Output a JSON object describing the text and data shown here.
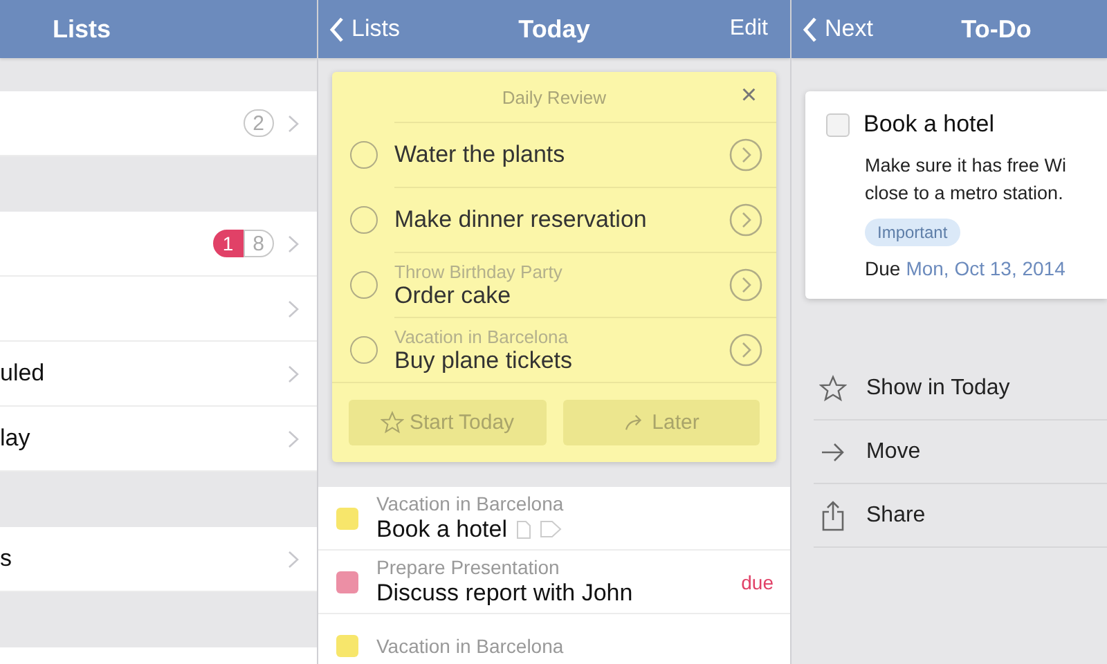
{
  "lists_pane": {
    "title": "Lists",
    "sections": [
      {
        "rows": [
          {
            "badges": [
              {
                "kind": "count",
                "text": "2"
              }
            ]
          }
        ]
      },
      {
        "rows": [
          {
            "badges": [
              {
                "kind": "due",
                "text": "1"
              },
              {
                "kind": "count",
                "text": "8"
              }
            ]
          },
          {},
          {
            "label": "uled"
          },
          {
            "label": "lay"
          }
        ]
      },
      {
        "rows": [
          {
            "label": "s"
          }
        ]
      },
      {
        "rows": [
          {}
        ]
      }
    ]
  },
  "today_pane": {
    "back": "Lists",
    "title": "Today",
    "action": "Edit",
    "review": {
      "title": "Daily Review",
      "close": "×",
      "items": [
        {
          "title": "Water the plants",
          "checked": false
        },
        {
          "title": "Make dinner reservation",
          "checked": false
        },
        {
          "project": "Throw Birthday Party",
          "title": "Order cake",
          "checked": false
        },
        {
          "project": "Vacation in Barcelona",
          "title": "Buy plane tickets",
          "checked": false
        }
      ],
      "buttons": [
        {
          "kind": "star",
          "label": "Start Today",
          "disabled": true
        },
        {
          "kind": "later",
          "label": "Later",
          "disabled": true
        }
      ]
    },
    "tasks": [
      {
        "project": "Vacation in Barcelona",
        "title": "Book a hotel",
        "color": "#f7e66b",
        "note": true,
        "tag": true
      },
      {
        "project": "Prepare Presentation",
        "title": "Discuss report with John",
        "color": "#ec8fa5",
        "due": "due"
      },
      {
        "project": "Vacation in Barcelona",
        "color": "#f7e66b"
      }
    ]
  },
  "todo_pane": {
    "back": "Next",
    "title": "To-Do",
    "card": {
      "checked": false,
      "title": "Book a hotel",
      "notes": [
        "Make sure it has free Wi",
        "close to a metro station."
      ],
      "tag": "Important",
      "due_label": "Due",
      "due_date": "Mon, Oct 13, 2014"
    },
    "actions": [
      {
        "kind": "star",
        "label": "Show in Today"
      },
      {
        "kind": "move",
        "label": "Move"
      },
      {
        "kind": "share",
        "label": "Share"
      }
    ]
  }
}
